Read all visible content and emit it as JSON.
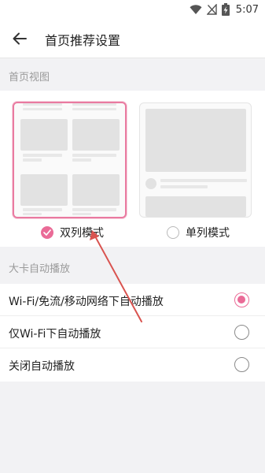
{
  "status_bar": {
    "time": "5:07",
    "icons": [
      "wifi-icon",
      "no-signal-icon",
      "battery-charging-icon"
    ]
  },
  "app_bar": {
    "title": "首页推荐设置",
    "back_icon": "arrow-left-icon"
  },
  "home_view": {
    "section_title": "首页视图",
    "options": [
      {
        "label": "双列模式",
        "selected": true
      },
      {
        "label": "单列模式",
        "selected": false
      }
    ]
  },
  "autoplay": {
    "section_title": "大卡自动播放",
    "options": [
      {
        "label": "Wi-Fi/免流/移动网络下自动播放",
        "selected": true
      },
      {
        "label": "仅Wi-Fi下自动播放",
        "selected": false
      },
      {
        "label": "关闭自动播放",
        "selected": false
      }
    ]
  },
  "colors": {
    "accent": "#ea6b97",
    "annotation_arrow": "#d9534f"
  }
}
